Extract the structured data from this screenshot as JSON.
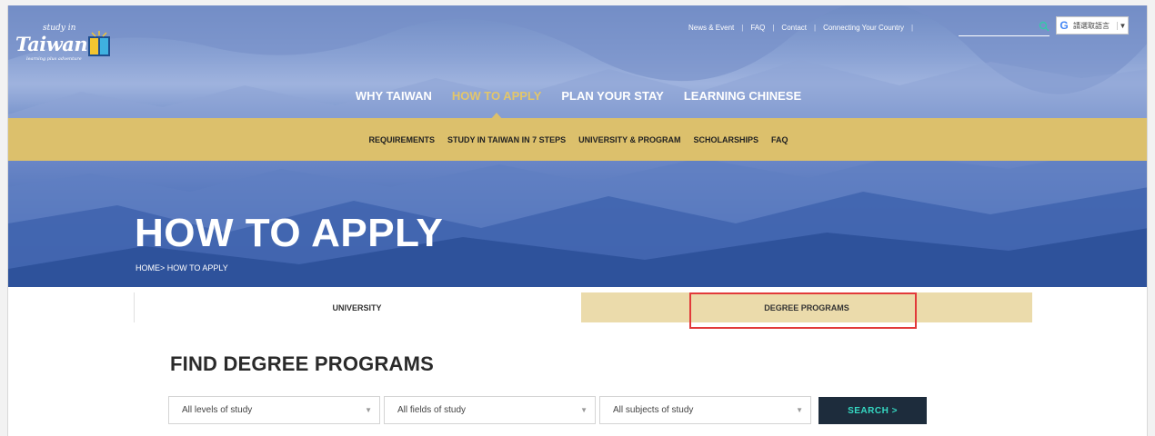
{
  "logo": {
    "small": "study in",
    "main": "Taiwan",
    "tag": "learning plus adventure"
  },
  "util_nav": [
    "News & Event",
    "FAQ",
    "Contact",
    "Connecting Your Country"
  ],
  "translate": {
    "g": "G",
    "label": "請選取語言",
    "caret": "▼"
  },
  "main_nav": [
    "WHY TAIWAN",
    "HOW TO APPLY",
    "PLAN YOUR STAY",
    "LEARNING CHINESE"
  ],
  "sub_nav": [
    "REQUIREMENTS",
    "STUDY IN TAIWAN IN 7 STEPS",
    "UNIVERSITY & PROGRAM",
    "SCHOLARSHIPS",
    "FAQ"
  ],
  "hero": {
    "title": "HOW TO APPLY",
    "breadcrumb": "HOME> HOW TO APPLY"
  },
  "tabs": {
    "university": "UNIVERSITY",
    "degree": "DEGREE PROGRAMS"
  },
  "section_title": "FIND DEGREE PROGRAMS",
  "filters": {
    "levels": "All levels of study",
    "fields": "All fields of study",
    "subjects": "All subjects of study",
    "caret": "▼",
    "search": "SEARCH  >"
  },
  "colors": {
    "gold": "#dcc06c",
    "tab_active": "#ebdbab",
    "search_btn": "#1d2c3c",
    "search_text": "#35d9c3",
    "highlight": "#e23a3a"
  }
}
